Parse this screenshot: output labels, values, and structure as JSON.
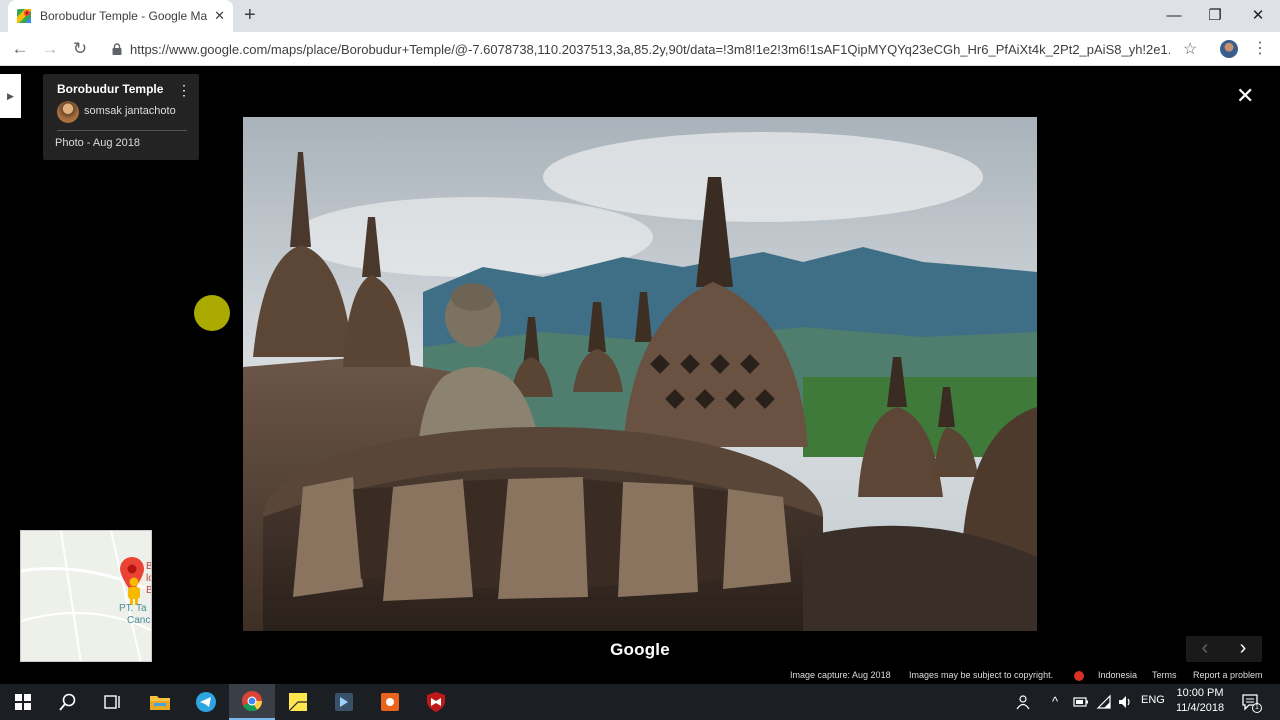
{
  "browser": {
    "tab_title": "Borobudur Temple - Google Maps",
    "tab_close": "✕",
    "new_tab": "+",
    "url": "https://www.google.com/maps/place/Borobudur+Temple/@-7.6078738,110.2037513,3a,85.2y,90t/data=!3m8!1e2!3m6!1sAF1QipMYQYq23eCGh_Hr6_PfAiXt4k_2Pt2_pAiS8_yh!2e1...",
    "window_controls": {
      "minimize": "—",
      "restore": "❐",
      "close": "✕"
    },
    "nav": {
      "back": "←",
      "forward": "→",
      "reload": "↻"
    },
    "star": "☆",
    "menu": "⋮",
    "favicon_colors": [
      "#34a853",
      "#ea4335",
      "#4285f4",
      "#fbbc04"
    ]
  },
  "viewer": {
    "place_title": "Borobudur Temple",
    "author": "somsak jantachoto",
    "photo_date": "Photo - Aug 2018",
    "more": "⋮",
    "close": "✕",
    "panel_toggle": "▶",
    "brand": "Google",
    "pager": {
      "prev": "‹",
      "next": "›"
    },
    "minimap_labels": [
      "PT. Ta",
      "Canc",
      "B",
      "lo",
      "B"
    ],
    "pin_color": "#ea4335",
    "pegman_color": "#f6b900"
  },
  "footer": {
    "capture": "Image capture: Aug 2018",
    "copyright": "Images may be subject to copyright.",
    "country": "Indonesia",
    "terms": "Terms",
    "report": "Report a problem"
  },
  "taskbar": {
    "apps": [
      "start-icon",
      "search-icon",
      "task-view-icon",
      "file-explorer-icon",
      "telegram-icon",
      "chrome-icon",
      "sticky-notes-icon",
      "app-icon",
      "app-orange-icon",
      "mcafee-icon"
    ],
    "language": "ENG",
    "time": "10:00 PM",
    "date": "11/4/2018",
    "tray_up": "^",
    "notif_badge": "1",
    "accent": "#76b9ed"
  }
}
